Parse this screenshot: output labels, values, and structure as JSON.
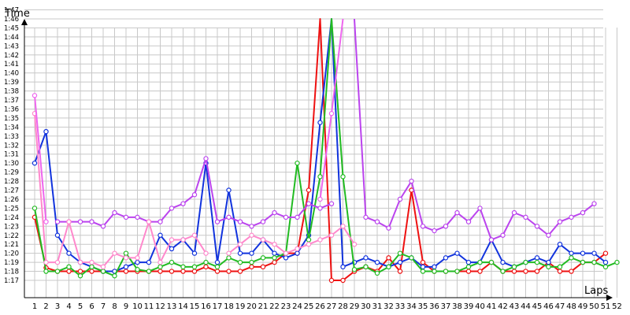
{
  "chart_data": {
    "type": "line",
    "title": "",
    "ylabel": "Time",
    "xlabel": "Laps",
    "grid": true,
    "legend": "none",
    "x_tick_labels": [
      "1",
      "2",
      "3",
      "4",
      "5",
      "6",
      "7",
      "8",
      "9",
      "10",
      "11",
      "12",
      "13",
      "14",
      "15",
      "16",
      "17",
      "18",
      "19",
      "20",
      "21",
      "22",
      "23",
      "24",
      "25",
      "26",
      "27",
      "28",
      "29",
      "30",
      "31",
      "32",
      "33",
      "34",
      "35",
      "36",
      "37",
      "38",
      "39",
      "40",
      "41",
      "42",
      "43",
      "44",
      "45",
      "46",
      "47",
      "48",
      "49",
      "50",
      "51",
      "52"
    ],
    "y_tick_labels": [
      "1:17",
      "1:18",
      "1:19",
      "1:20",
      "1:21",
      "1:22",
      "1:23",
      "1:24",
      "1:25",
      "1:26",
      "1:27",
      "1:28",
      "1:29",
      "1:30",
      "1:31",
      "1:32",
      "1:33",
      "1:34",
      "1:35",
      "1:36",
      "1:37",
      "1:38",
      "1:39",
      "1:40",
      "1:41",
      "1:42",
      "1:43",
      "1:44",
      "1:45",
      "1:46",
      "1:47"
    ],
    "y_unit": "seconds",
    "ylim": [
      76,
      108
    ],
    "xlim": [
      0.3,
      52.5
    ],
    "series": [
      {
        "color": "#ee1111",
        "values": [
          84,
          78.4,
          78,
          78,
          78,
          78,
          78,
          78,
          78,
          78,
          78,
          78,
          78,
          78,
          78,
          78.5,
          78,
          78,
          78,
          78.5,
          78.5,
          79,
          80,
          80,
          87,
          108,
          77,
          77,
          78,
          78.5,
          78,
          79.5,
          78,
          87,
          79,
          78,
          78,
          78,
          78,
          78,
          79,
          78,
          78,
          78,
          78,
          79,
          78,
          78,
          79,
          79,
          80,
          null
        ]
      },
      {
        "color": "#1133dd",
        "values": [
          90,
          93.5,
          82,
          80,
          79,
          78.5,
          78,
          78,
          78.5,
          79,
          79,
          82,
          80.5,
          81.5,
          80,
          90,
          79,
          87,
          80,
          80,
          81.5,
          80,
          79.5,
          80,
          82,
          94.5,
          108,
          78.5,
          79,
          79.5,
          79,
          78.5,
          79,
          79.5,
          78.5,
          78.5,
          79.5,
          80,
          79,
          79,
          81.5,
          79,
          78.5,
          79,
          79.5,
          79,
          81,
          80,
          80,
          80,
          79,
          null
        ]
      },
      {
        "color": "#22bb22",
        "values": [
          85,
          78,
          78,
          78.5,
          77.5,
          78.5,
          78,
          77.5,
          80,
          78.2,
          78,
          78.5,
          79,
          78.5,
          78.5,
          79,
          78.5,
          79.5,
          79,
          79,
          79.5,
          79.5,
          80,
          90,
          81.5,
          88.5,
          108,
          88.5,
          78.2,
          78.5,
          77.8,
          78.5,
          80,
          79.5,
          78,
          78,
          78,
          78,
          78.5,
          79,
          79,
          78,
          78.5,
          79,
          79,
          78.5,
          78.5,
          79.5,
          79,
          79,
          78.5,
          79
        ]
      },
      {
        "color": "#bb44ee",
        "values": [
          null,
          null,
          83.5,
          83.5,
          83.5,
          83.5,
          83,
          84.5,
          84,
          84,
          83.5,
          83.5,
          85,
          85.5,
          86.5,
          90.5,
          83.5,
          84,
          83.5,
          83,
          83.5,
          84.5,
          84,
          84,
          85.5,
          85,
          85.5,
          null,
          108,
          84,
          83.5,
          82.8,
          86,
          88,
          83,
          82.5,
          83,
          84.5,
          83.5,
          85,
          81.5,
          82,
          84.5,
          84,
          83,
          82,
          83.5,
          84,
          84.5,
          85.5,
          null,
          null
        ]
      },
      {
        "color": "#ff88cc",
        "values": [
          95.5,
          79,
          79,
          83.5,
          79,
          79,
          78.5,
          80,
          79.5,
          79.5,
          83.5,
          79,
          81.5,
          81.5,
          82,
          80,
          null,
          80,
          81,
          82,
          81.5,
          81,
          80,
          80.5,
          81,
          81.5,
          82,
          83,
          81,
          null,
          null,
          null,
          null,
          null,
          null,
          null,
          null,
          null,
          null,
          null,
          null,
          null,
          null,
          null,
          null,
          null,
          null,
          null,
          null,
          null,
          null,
          null
        ]
      },
      {
        "color": "#ee66ee",
        "values": [
          97.5,
          83.5,
          null,
          null,
          null,
          null,
          null,
          null,
          null,
          null,
          null,
          null,
          null,
          null,
          null,
          null,
          null,
          null,
          null,
          null,
          null,
          null,
          null,
          null,
          null,
          86,
          95.5,
          108,
          null,
          null,
          null,
          null,
          null,
          null,
          null,
          null,
          null,
          null,
          null,
          null,
          null,
          null,
          null,
          null,
          null,
          null,
          null,
          null,
          null,
          null,
          null,
          null
        ]
      }
    ]
  }
}
